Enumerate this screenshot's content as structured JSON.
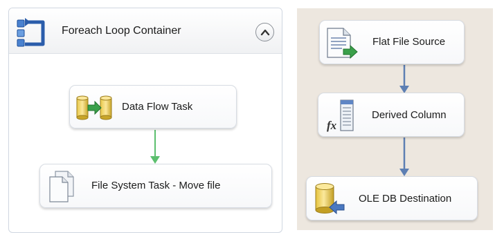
{
  "control_flow": {
    "container": {
      "title": "Foreach Loop Container",
      "icon": "foreach-loop-icon",
      "collapse_icon": "chevron-up-icon"
    },
    "tasks": [
      {
        "label": "Data Flow Task",
        "icon": "data-flow-task-icon"
      },
      {
        "label": "File System Task - Move file",
        "icon": "file-system-task-icon"
      }
    ],
    "connector_color": "#5cbf6e"
  },
  "data_flow": {
    "components": [
      {
        "label": "Flat File Source",
        "icon": "flat-file-source-icon"
      },
      {
        "label": "Derived Column",
        "icon": "derived-column-icon"
      },
      {
        "label": "OLE DB Destination",
        "icon": "ole-db-destination-icon"
      }
    ],
    "connector_color": "#5d7fb3",
    "background": "#ede7df"
  }
}
